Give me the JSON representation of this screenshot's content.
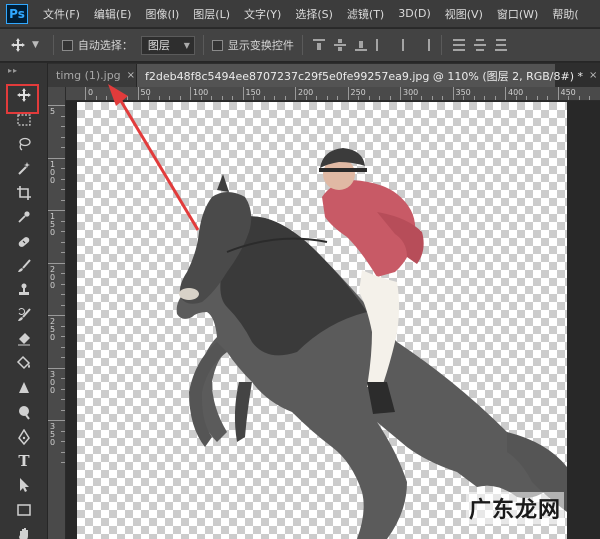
{
  "app": {
    "logo": "Ps"
  },
  "menu": [
    "文件(F)",
    "编辑(E)",
    "图像(I)",
    "图层(L)",
    "文字(Y)",
    "选择(S)",
    "滤镜(T)",
    "3D(D)",
    "视图(V)",
    "窗口(W)",
    "帮助("
  ],
  "options": {
    "auto_select_label": "自动选择：",
    "layer_select_value": "图层",
    "show_transform_label": "显示变换控件"
  },
  "tabs": [
    {
      "label": "timg (1).jpg",
      "close": "×",
      "active": false
    },
    {
      "label": "f2deb48f8c5494ee8707237c29f5e0fe99257ea9.jpg @ 110% (图层 2, RGB/8#) *",
      "close": "×",
      "active": true
    }
  ],
  "ruler": {
    "top_labels": [
      "0",
      "50",
      "100",
      "150",
      "200",
      "250",
      "300",
      "350",
      "400",
      "450"
    ],
    "left_labels": [
      "5",
      "1 0 0",
      "1 5 0",
      "2 0 0",
      "2 5 0",
      "3 0 0",
      "3 5 0"
    ]
  },
  "toolbar": {
    "grip": "▸▸",
    "tools": [
      "move-tool",
      "marquee-tool",
      "lasso-tool",
      "magic-wand-tool",
      "crop-tool",
      "eyedropper-tool",
      "healing-brush-tool",
      "brush-tool",
      "clone-stamp-tool",
      "history-brush-tool",
      "eraser-tool",
      "paint-bucket-tool",
      "blur-tool",
      "dodge-tool",
      "pen-tool",
      "type-tool",
      "path-selection-tool",
      "rectangle-tool",
      "hand-tool"
    ],
    "type_glyph": "T"
  },
  "watermark": "广东龙网",
  "colors": {
    "highlight": "#e23b3b",
    "arrow": "#e23b3b",
    "jacket": "#c85a66"
  }
}
